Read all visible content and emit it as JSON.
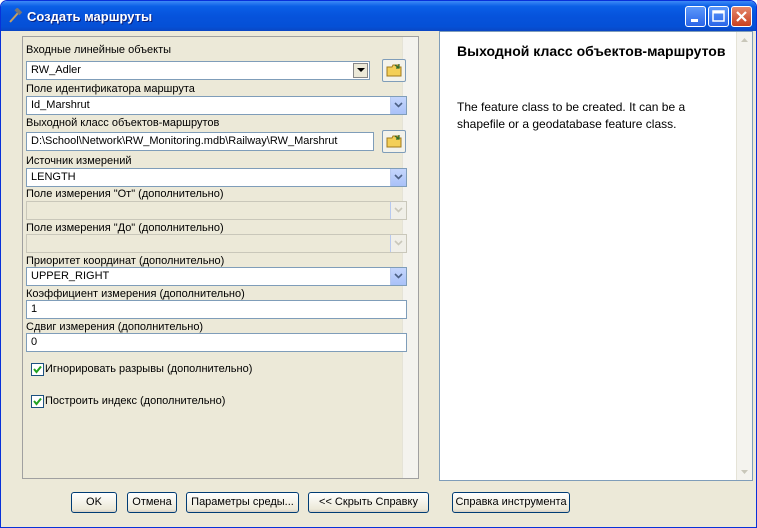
{
  "window": {
    "title": "Создать маршруты"
  },
  "params": {
    "input_label": "Входные линейные объекты",
    "input_value": "RW_Adler",
    "route_id_label": "Поле идентификатора маршрута",
    "route_id_value": "Id_Marshrut",
    "output_label": "Выходной класс объектов-маршрутов",
    "output_value": "D:\\School\\Network\\RW_Monitoring.mdb\\Railway\\RW_Marshrut",
    "measure_source_label": "Источник измерений",
    "measure_source_value": "LENGTH",
    "from_field_label": "Поле измерения \"От\" (дополнительно)",
    "from_field_value": "",
    "to_field_label": "Поле измерения \"До\" (дополнительно)",
    "to_field_value": "",
    "priority_label": "Приоритет координат (дополнительно)",
    "priority_value": "UPPER_RIGHT",
    "factor_label": "Коэффициент измерения (дополнительно)",
    "factor_value": "1",
    "offset_label": "Сдвиг измерения (дополнительно)",
    "offset_value": "0",
    "ignore_gaps_label": "Игнорировать разрывы (дополнительно)",
    "ignore_gaps_checked": true,
    "build_index_label": "Построить индекс (дополнительно)",
    "build_index_checked": true
  },
  "help": {
    "title": "Выходной класс объектов-маршрутов",
    "text": "The feature class to be created. It can be a shapefile or a geodatabase feature class."
  },
  "buttons": {
    "ok": "OK",
    "cancel": "Отмена",
    "environments": "Параметры среды...",
    "hide_help": "<< Скрыть Справку",
    "tool_help": "Справка инструмента"
  }
}
